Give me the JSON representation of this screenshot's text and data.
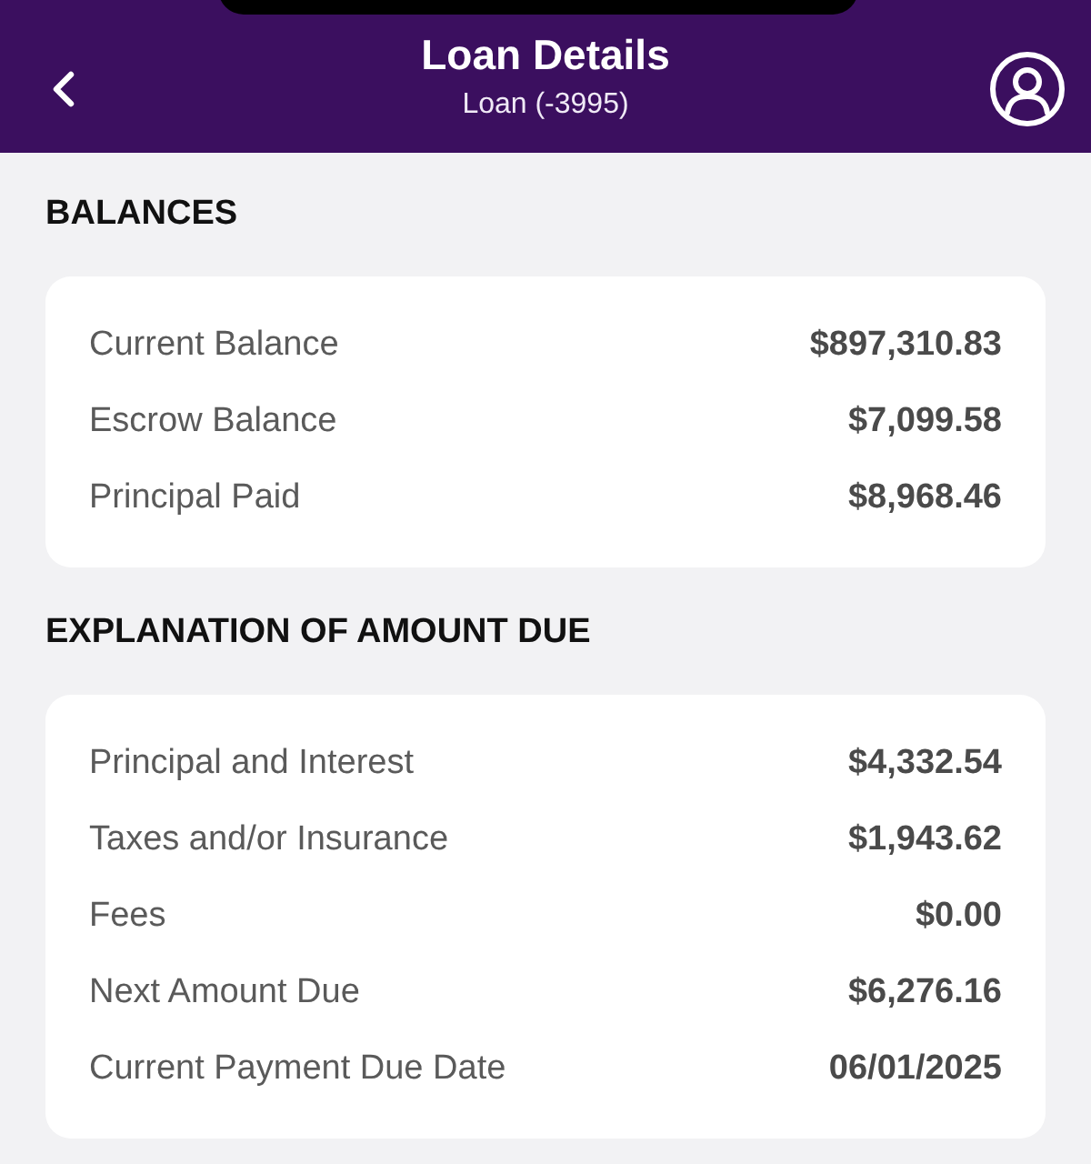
{
  "header": {
    "title": "Loan Details",
    "subtitle": "Loan (-3995)"
  },
  "sections": [
    {
      "heading": "BALANCES",
      "rows": [
        {
          "label": "Current Balance",
          "value": "$897,310.83"
        },
        {
          "label": "Escrow Balance",
          "value": "$7,099.58"
        },
        {
          "label": "Principal Paid",
          "value": "$8,968.46"
        }
      ]
    },
    {
      "heading": "EXPLANATION OF AMOUNT DUE",
      "rows": [
        {
          "label": "Principal and Interest",
          "value": "$4,332.54"
        },
        {
          "label": "Taxes and/or Insurance",
          "value": "$1,943.62"
        },
        {
          "label": "Fees",
          "value": "$0.00"
        },
        {
          "label": "Next Amount Due",
          "value": "$6,276.16"
        },
        {
          "label": "Current Payment Due Date",
          "value": "06/01/2025"
        }
      ]
    }
  ]
}
